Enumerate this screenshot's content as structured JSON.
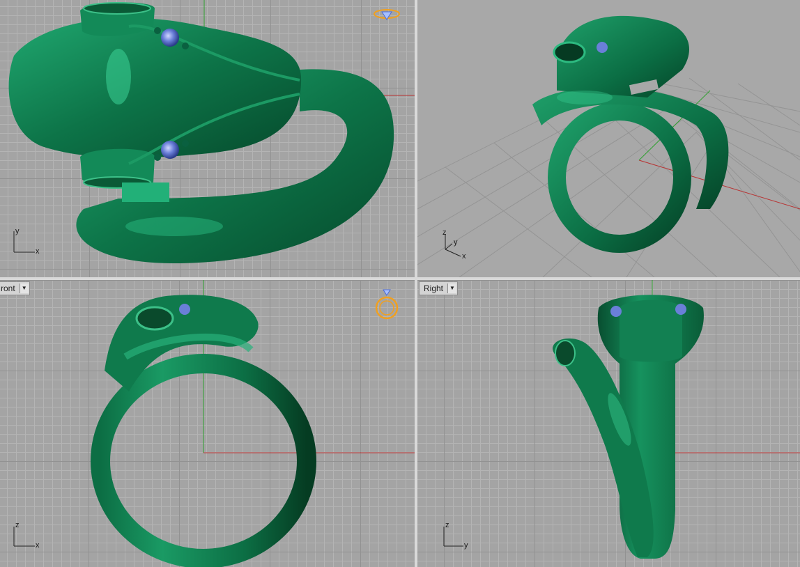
{
  "viewports": {
    "top": {
      "axis_x": "x",
      "axis_y": "y"
    },
    "perspective": {
      "axis_x": "x",
      "axis_y": "y",
      "axis_z": "z"
    },
    "front": {
      "tab_label": "ront",
      "axis_x": "x",
      "axis_z": "z"
    },
    "right": {
      "tab_label": "Right",
      "axis_y": "y",
      "axis_z": "z"
    }
  },
  "icons": {
    "dropdown": "chevron-down-icon",
    "widget": "ring-diamond-icon"
  },
  "colors": {
    "viewport_bg": "#a4a4a4",
    "model_green": "#0f7a4c",
    "x_axis": "#b83030",
    "y_axis": "#2ea02e",
    "gem": "#4a5fb8",
    "widget": "#f0a020"
  }
}
